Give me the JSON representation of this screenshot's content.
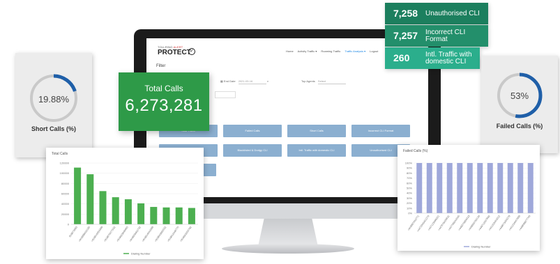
{
  "app": {
    "logo_top": "TOLLRING ",
    "logo_top_red": "ALERT",
    "logo_main": "PROTECT",
    "logo_mark": "✓",
    "nav": [
      "Home",
      "Activity Traffic ▾",
      "Roaming Traffic",
      "Traffic Analysis ▾",
      "Logout"
    ],
    "nav_active_index": 3,
    "filter_label": "Filter",
    "fields": {
      "end_date_label": "End Date",
      "end_date_value": "2021-03-16",
      "top_agents_label": "Top Agents",
      "top_agents_placeholder": "Select"
    },
    "chips": [
      "Total Traffic",
      "Failed Calls",
      "Short Calls",
      "Incorrect CLI Format",
      "Unauthorised CLI",
      "Blacklisted & Dodgy CLI",
      "Intl. Traffic with domestic CLI",
      "Unauthorised CLI",
      "Wrong Bin"
    ],
    "colors": {
      "chip": "#8bafd0",
      "active_nav": "#1e88e5"
    }
  },
  "total_calls": {
    "label": "Total Calls",
    "value": "6,273,281",
    "color": "#2e9a48"
  },
  "cli_stats": [
    {
      "value": "7,258",
      "label": "Unauthorised CLI",
      "color": "#1c7f5e"
    },
    {
      "value": "7,257",
      "label": "Incorrect CLI Format",
      "color": "#238f6b"
    },
    {
      "value": "260",
      "label": "Intl. Traffic with domestic CLI",
      "color": "#2bae8c"
    }
  ],
  "gauges": {
    "short_calls": {
      "value_text": "19.88%",
      "fraction": 0.1988,
      "label": "Short Calls (%)",
      "color": "#1f5fa8",
      "track": "#c9c9c9"
    },
    "failed_calls": {
      "value_text": "53%",
      "fraction": 0.53,
      "label": "Failed Calls (%)",
      "color": "#1f5fa8",
      "track": "#c9c9c9"
    }
  },
  "chart_data": [
    {
      "type": "bar",
      "title": "Total Calls",
      "legend": "Dialing Number",
      "legend_position": "bottom",
      "color": "#4caf50",
      "ylim": [
        0,
        120000
      ],
      "yticks": [
        "0",
        "20000",
        "40000",
        "60000",
        "80000",
        "100000",
        "120000"
      ],
      "categories": [
        "919873883",
        "+919999432195",
        "+919816053489",
        "+919876477532",
        "+919823849965",
        "+919829462732",
        "+919814542689",
        "+919843892632",
        "+919812448775",
        "+919843263792"
      ],
      "values": [
        111000,
        98000,
        65000,
        53000,
        49000,
        41000,
        34000,
        33000,
        33000,
        32000
      ]
    },
    {
      "type": "bar",
      "title": "Failed Calls (%)",
      "legend": "Dialing Number",
      "legend_position": "bottom",
      "color": "#9fa8da",
      "ylim": [
        0,
        100
      ],
      "yticks": [
        "0%",
        "10%",
        "20%",
        "30%",
        "40%",
        "50%",
        "60%",
        "70%",
        "80%",
        "90%",
        "100%"
      ],
      "categories": [
        "+919987652771",
        "+4472046461274",
        "+447123098321",
        "+447878436831",
        "+447789342645",
        "+449376894323",
        "+449856782134",
        "+449712567892",
        "+441203453312",
        "+449873456278",
        "+441234567890",
        "+449898877766"
      ],
      "values": [
        100,
        100,
        100,
        100,
        100,
        100,
        100,
        100,
        100,
        100,
        100,
        100
      ]
    }
  ]
}
